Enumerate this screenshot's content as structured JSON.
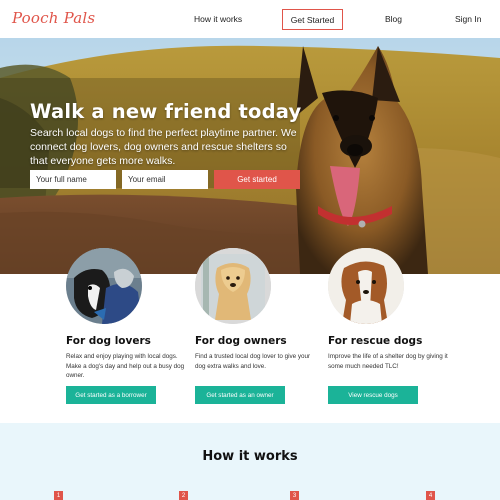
{
  "nav": {
    "logo": "Pooch Pals",
    "links": [
      "How it works",
      "Get Started",
      "Blog",
      "Sign In"
    ]
  },
  "hero": {
    "title": "Walk a new friend today",
    "subtitle": "Search local dogs to find the perfect playtime partner. We connect dog lovers, dog owners and rescue shelters so that everyone gets more walks.",
    "name_placeholder": "Your full  name",
    "email_placeholder": "Your email",
    "cta": "Get started"
  },
  "cards": [
    {
      "title": "For dog lovers",
      "text": "Relax and enjoy playing with local dogs. Make a dog's day and help out a busy dog owner.",
      "button": "Get started as a borrower"
    },
    {
      "title": "For dog owners",
      "text": "Find a trusted local dog lover to give your dog extra walks and love.",
      "button": "Get started as an owner"
    },
    {
      "title": "For rescue dogs",
      "text": "Improve the life of a shelter dog by giving it some much needed TLC!",
      "button": "View rescue dogs"
    }
  ],
  "how": {
    "title": "How it works",
    "steps": [
      "1",
      "2",
      "3",
      "4"
    ]
  },
  "colors": {
    "brand": "#e0554a",
    "accent": "#1bb398",
    "section_bg": "#e9f6fb"
  }
}
